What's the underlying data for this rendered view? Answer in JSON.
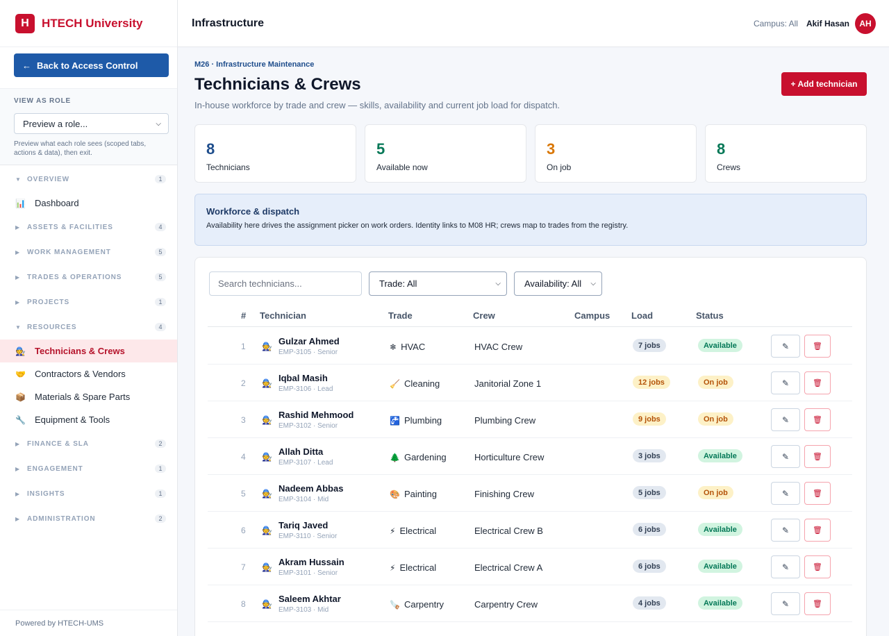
{
  "brand": {
    "logo_letter": "H",
    "name": "HTECH University"
  },
  "sidebar": {
    "back_label": "Back to Access Control",
    "back_icon": "←",
    "role_title": "VIEW AS ROLE",
    "role_select_value": "Preview a role...",
    "role_hint": "Preview what each role sees (scoped tabs, actions & data), then exit.",
    "sections": [
      {
        "label": "OVERVIEW",
        "count": "1",
        "caret": "▼"
      },
      {
        "label": "ASSETS & FACILITIES",
        "count": "4",
        "caret": "▶"
      },
      {
        "label": "WORK MANAGEMENT",
        "count": "5",
        "caret": "▶"
      },
      {
        "label": "TRADES & OPERATIONS",
        "count": "5",
        "caret": "▶"
      },
      {
        "label": "PROJECTS",
        "count": "1",
        "caret": "▶"
      },
      {
        "label": "RESOURCES",
        "count": "4",
        "caret": "▼"
      },
      {
        "label": "FINANCE & SLA",
        "count": "2",
        "caret": "▶"
      },
      {
        "label": "ENGAGEMENT",
        "count": "1",
        "caret": "▶"
      },
      {
        "label": "INSIGHTS",
        "count": "1",
        "caret": "▶"
      },
      {
        "label": "ADMINISTRATION",
        "count": "2",
        "caret": "▶"
      }
    ],
    "overview_items": [
      {
        "label": "Dashboard",
        "icon": "📊"
      }
    ],
    "resources_items": [
      {
        "label": "Technicians & Crews",
        "icon": "🧑‍🔧"
      },
      {
        "label": "Contractors & Vendors",
        "icon": "🤝"
      },
      {
        "label": "Materials & Spare Parts",
        "icon": "📦"
      },
      {
        "label": "Equipment & Tools",
        "icon": "🔧"
      }
    ],
    "footer": "Powered by HTECH-UMS"
  },
  "header": {
    "title": "Infrastructure",
    "campus": "Campus: All",
    "user": "Akif Hasan",
    "avatar_initials": "AH"
  },
  "page": {
    "eyebrow": "M26 · Infrastructure Maintenance",
    "title": "Technicians & Crews",
    "subtitle": "In-house workforce by trade and crew — skills, availability and current job load for dispatch.",
    "add_button": "+ Add technician"
  },
  "stats": [
    {
      "value": "8",
      "label": "Technicians",
      "color": "#1e4d8c"
    },
    {
      "value": "5",
      "label": "Available now",
      "color": "#047857"
    },
    {
      "value": "3",
      "label": "On job",
      "color": "#d97706"
    },
    {
      "value": "8",
      "label": "Crews",
      "color": "#047857"
    }
  ],
  "notice": {
    "title": "Workforce & dispatch",
    "body": "Availability here drives the assignment picker on work orders. Identity links to M08 HR; crews map to trades from the registry."
  },
  "filters": {
    "search_placeholder": "Search technicians...",
    "trade_value": "Trade: All",
    "availability_value": "Availability: All"
  },
  "table": {
    "headers": {
      "idx": "#",
      "technician": "Technician",
      "trade": "Trade",
      "crew": "Crew",
      "campus": "Campus",
      "load": "Load",
      "status": "Status"
    },
    "rows": [
      {
        "idx": "1",
        "name": "Gulzar Ahmed",
        "meta": "EMP-3105 · Senior",
        "trade_icon": "❄",
        "trade": "HVAC",
        "crew": "HVAC Crew",
        "load": "7 jobs",
        "load_level": "normal",
        "status": "Available"
      },
      {
        "idx": "2",
        "name": "Iqbal Masih",
        "meta": "EMP-3106 · Lead",
        "trade_icon": "🧹",
        "trade": "Cleaning",
        "crew": "Janitorial Zone 1",
        "load": "12 jobs",
        "load_level": "high",
        "status": "On job"
      },
      {
        "idx": "3",
        "name": "Rashid Mehmood",
        "meta": "EMP-3102 · Senior",
        "trade_icon": "🚰",
        "trade": "Plumbing",
        "crew": "Plumbing Crew",
        "load": "9 jobs",
        "load_level": "high",
        "status": "On job"
      },
      {
        "idx": "4",
        "name": "Allah Ditta",
        "meta": "EMP-3107 · Lead",
        "trade_icon": "🌲",
        "trade": "Gardening",
        "crew": "Horticulture Crew",
        "load": "3 jobs",
        "load_level": "normal",
        "status": "Available"
      },
      {
        "idx": "5",
        "name": "Nadeem Abbas",
        "meta": "EMP-3104 · Mid",
        "trade_icon": "🎨",
        "trade": "Painting",
        "crew": "Finishing Crew",
        "load": "5 jobs",
        "load_level": "normal",
        "status": "On job"
      },
      {
        "idx": "6",
        "name": "Tariq Javed",
        "meta": "EMP-3110 · Senior",
        "trade_icon": "⚡",
        "trade": "Electrical",
        "crew": "Electrical Crew B",
        "load": "6 jobs",
        "load_level": "normal",
        "status": "Available"
      },
      {
        "idx": "7",
        "name": "Akram Hussain",
        "meta": "EMP-3101 · Senior",
        "trade_icon": "⚡",
        "trade": "Electrical",
        "crew": "Electrical Crew A",
        "load": "6 jobs",
        "load_level": "normal",
        "status": "Available"
      },
      {
        "idx": "8",
        "name": "Saleem Akhtar",
        "meta": "EMP-3103 · Mid",
        "trade_icon": "🪚",
        "trade": "Carpentry",
        "crew": "Carpentry Crew",
        "load": "4 jobs",
        "load_level": "normal",
        "status": "Available"
      }
    ],
    "tech_icon": "🧑‍🔧",
    "edit_icon": "✎",
    "delete_icon": "🗑"
  }
}
